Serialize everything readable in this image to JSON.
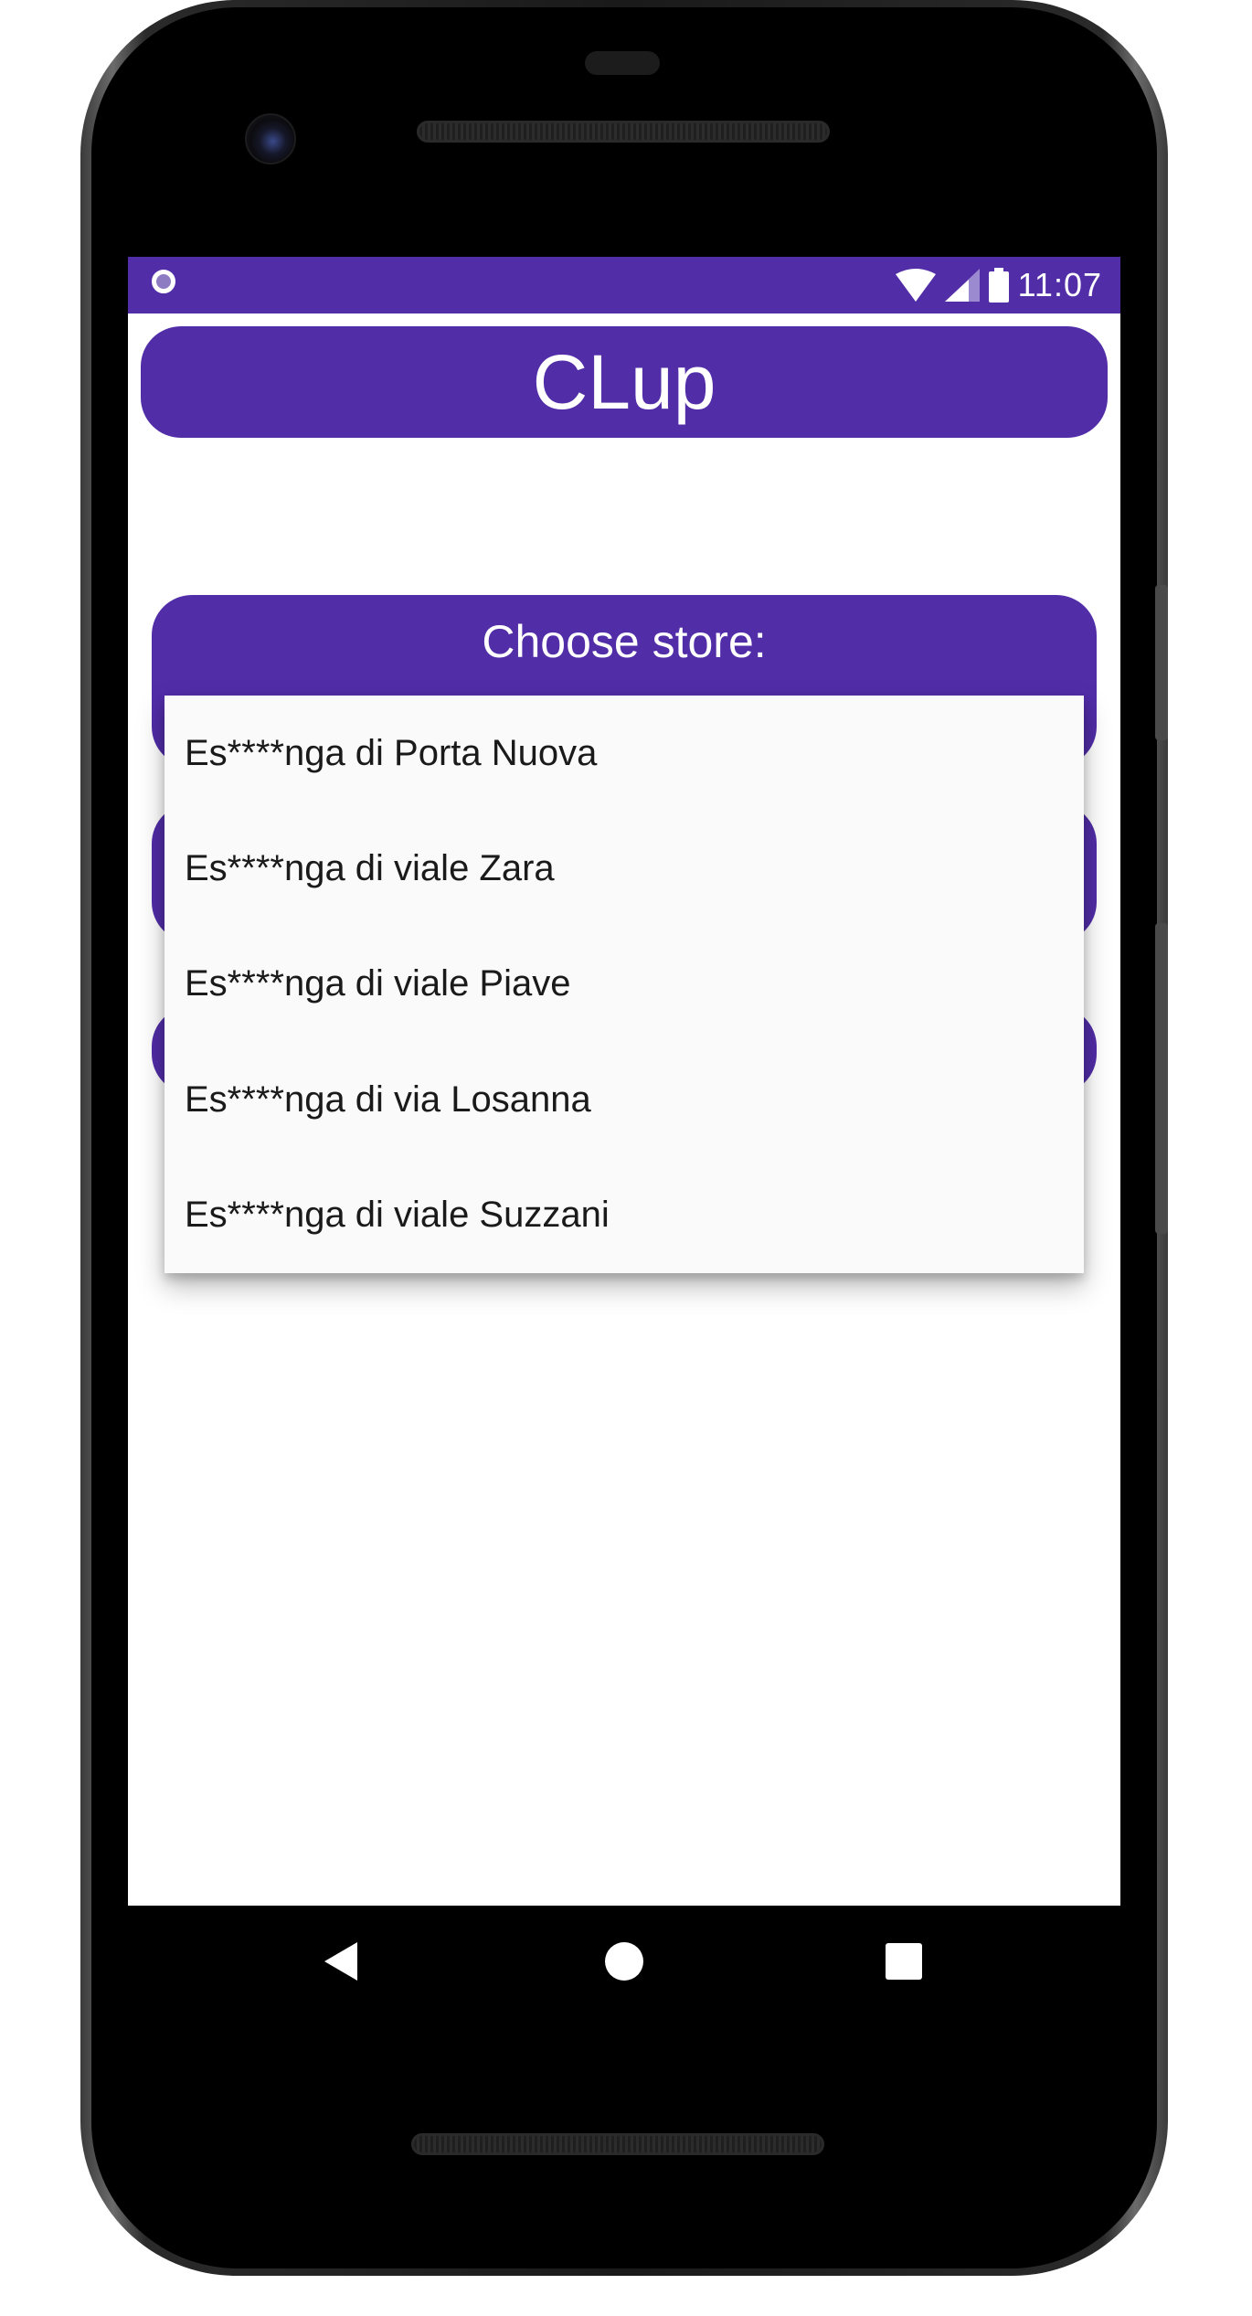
{
  "status_bar": {
    "time": "11:07"
  },
  "app": {
    "title": "CLup"
  },
  "store_picker": {
    "label": "Choose store:",
    "options": [
      "Es****nga di Porta Nuova",
      "Es****nga di viale Zara",
      "Es****nga di viale Piave",
      "Es****nga di via Losanna",
      "Es****nga di viale Suzzani"
    ]
  },
  "colors": {
    "accent": "#512da8",
    "dropdown_bg": "#fafafa"
  },
  "icons": {
    "status_left": "notification-circle-icon",
    "status_right": [
      "wifi-icon",
      "cell-signal-icon",
      "battery-icon"
    ],
    "nav": [
      "back-icon",
      "home-icon",
      "recents-icon"
    ]
  }
}
